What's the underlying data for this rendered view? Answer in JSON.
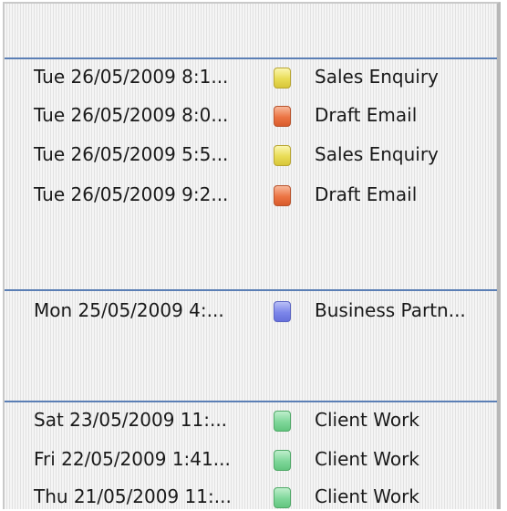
{
  "colors": {
    "separator": "#5b7fb5",
    "yellow": "#e9dc55",
    "orange": "#ec7443",
    "blue": "#7c86ea",
    "green": "#7fd79a"
  },
  "groups": [
    {
      "rows": [
        {
          "date": "Tue 26/05/2009 8:1...",
          "category": "Sales Enquiry",
          "color_icon": "yellow-category-swatch"
        },
        {
          "date": "Tue 26/05/2009 8:0...",
          "category": "Draft Email",
          "color_icon": "orange-category-swatch"
        },
        {
          "date": "Tue 26/05/2009 5:5...",
          "category": "Sales Enquiry",
          "color_icon": "yellow-category-swatch"
        },
        {
          "date": "Tue 26/05/2009 9:2...",
          "category": "Draft Email",
          "color_icon": "orange-category-swatch"
        }
      ]
    },
    {
      "rows": [
        {
          "date": "Mon 25/05/2009 4:...",
          "category": "Business Partn...",
          "color_icon": "blue-category-swatch"
        }
      ]
    },
    {
      "rows": [
        {
          "date": "Sat 23/05/2009 11:...",
          "category": "Client Work",
          "color_icon": "green-category-swatch"
        },
        {
          "date": "Fri 22/05/2009 1:41...",
          "category": "Client Work",
          "color_icon": "green-category-swatch"
        },
        {
          "date": "Thu 21/05/2009 11:...",
          "category": "Client Work",
          "color_icon": "green-category-swatch"
        }
      ]
    }
  ]
}
